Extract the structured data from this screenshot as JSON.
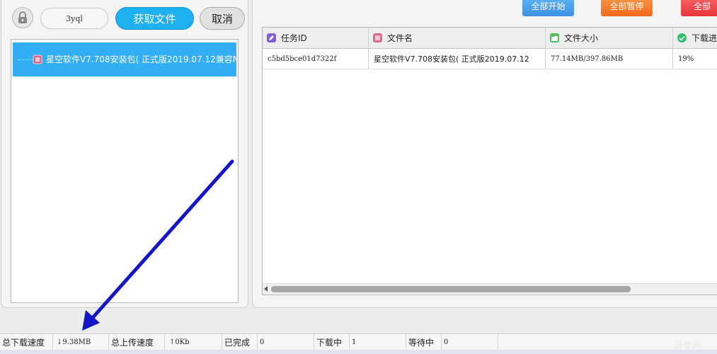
{
  "left": {
    "code_value": "3yql",
    "fetch_label": "获取文件",
    "cancel_label": "取消",
    "tree_item_label": "星空软件V7.708安装包( 正式版2019.07.12兼容N"
  },
  "toolbar": {
    "start_all": "全部开始",
    "pause_all": "全部暂停",
    "delete_all": "全部"
  },
  "table": {
    "headers": [
      "任务ID",
      "文件名",
      "文件大小",
      "下载进"
    ],
    "rows": [
      {
        "task_id": "c5bd5bce01d7322f",
        "file_name": "星空软件V7.708安装包( 正式版2019.07.12",
        "file_size": "77.14MB/397.86MB",
        "progress": "19%"
      }
    ]
  },
  "status": {
    "download_speed_label": "总下载速度",
    "download_speed_value": "↓9.38MB",
    "upload_speed_label": "总上传速度",
    "upload_speed_value": "↑0Kb",
    "completed_label": "已完成",
    "completed_value": "0",
    "downloading_label": "下载中",
    "downloading_value": "1",
    "waiting_label": "等待中",
    "waiting_value": "0"
  },
  "watermark": "晨荣网",
  "colors": {
    "accent_blue": "#1fb0f0",
    "start_button": "#3d93e3",
    "pause_button": "#f06a1c",
    "delete_button": "#e8343a",
    "selected_row": "#32aef5",
    "arrow": "#1515c8"
  },
  "icons": [
    "lock-icon",
    "file-icon",
    "edit-icon",
    "folder-icon",
    "check-circle-icon"
  ]
}
